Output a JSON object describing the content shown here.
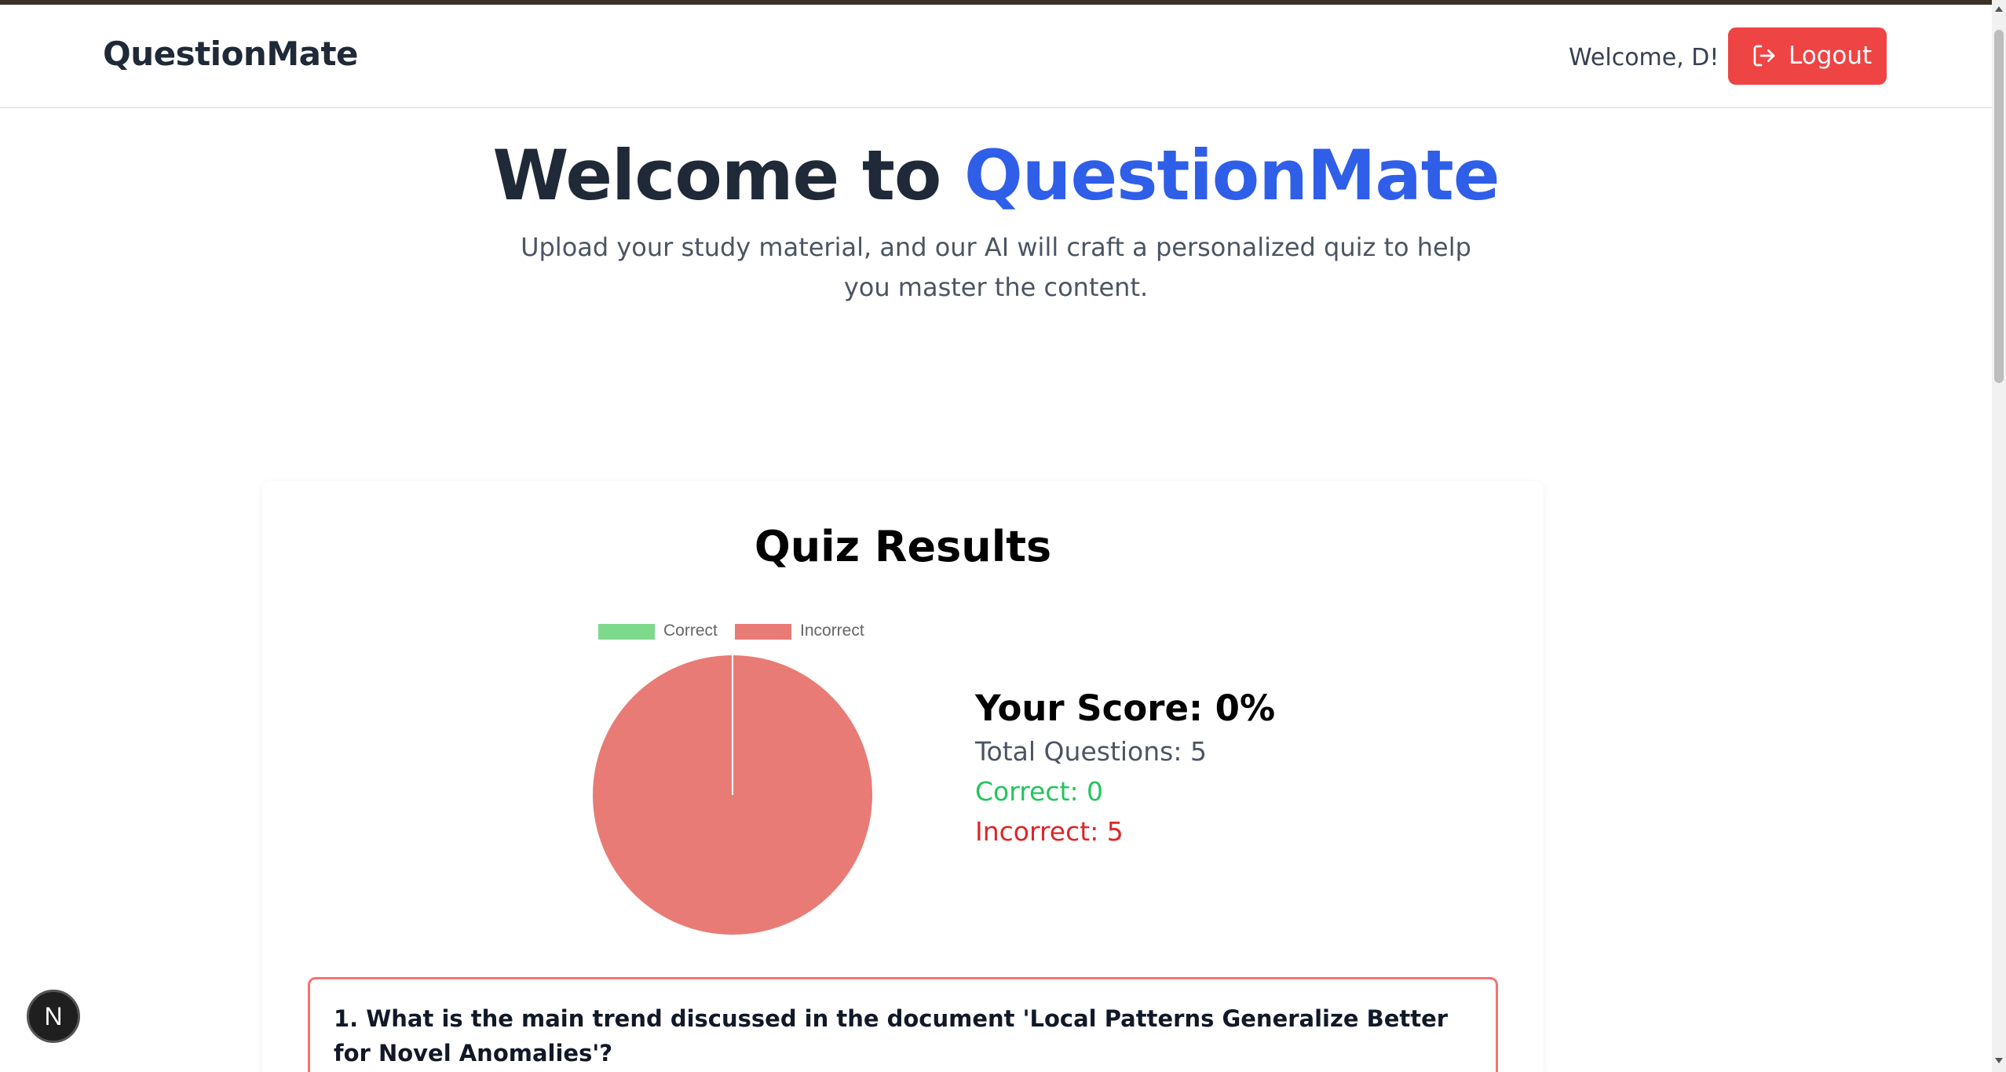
{
  "header": {
    "brand": "QuestionMate",
    "welcome": "Welcome, D!",
    "logout_label": "Logout"
  },
  "hero": {
    "title_prefix": "Welcome to ",
    "title_accent": "QuestionMate",
    "subtitle": "Upload your study material, and our AI will craft a personalized quiz to help you master the content."
  },
  "results": {
    "title": "Quiz Results",
    "score_label": "Your Score: 0%",
    "total_label": "Total Questions: 5",
    "correct_label": "Correct: 0",
    "incorrect_label": "Incorrect: 5"
  },
  "chart_data": {
    "type": "pie",
    "categories": [
      "Correct",
      "Incorrect"
    ],
    "values": [
      0,
      5
    ],
    "colors": [
      "#7ed98c",
      "#e87b75"
    ],
    "legend_position": "top"
  },
  "questions": [
    {
      "text": "1. What is the main trend discussed in the document 'Local Patterns Generalize Better for Novel Anomalies'?"
    }
  ],
  "dev_badge": {
    "letter": "N"
  }
}
